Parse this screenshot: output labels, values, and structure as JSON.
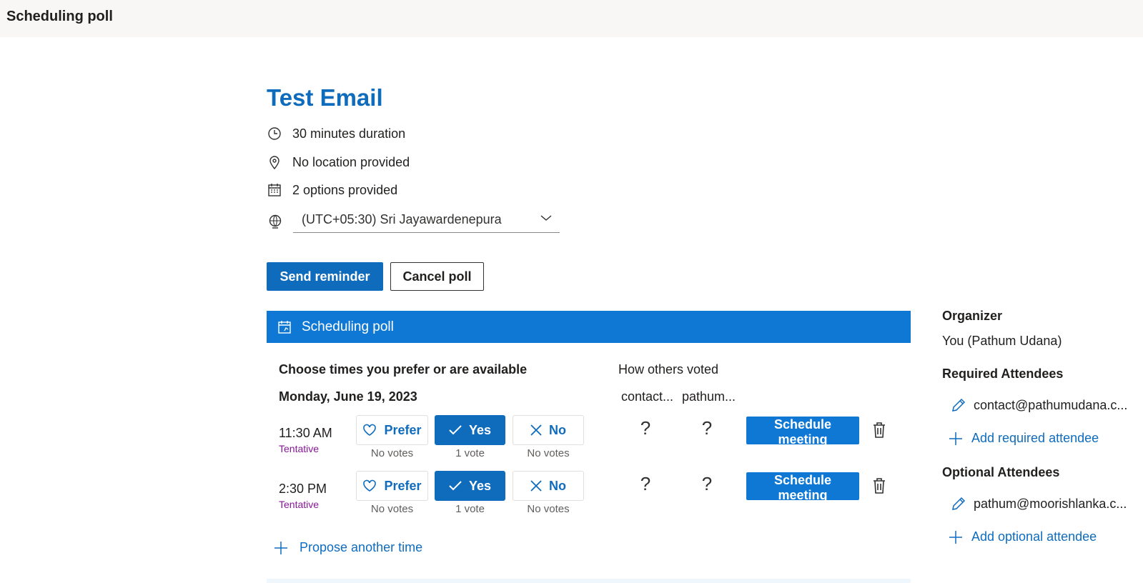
{
  "app": {
    "title": "Scheduling poll"
  },
  "event": {
    "title": "Test Email",
    "duration": "30 minutes duration",
    "location": "No location provided",
    "options": "2 options provided",
    "timezone": "(UTC+05:30) Sri Jayawardenepura"
  },
  "actions": {
    "send_reminder": "Send reminder",
    "cancel_poll": "Cancel poll"
  },
  "poll": {
    "header": "Scheduling poll",
    "choose_label": "Choose times you prefer or are available",
    "others_label": "How others voted",
    "date": "Monday, June 19, 2023",
    "voters": [
      "contact...",
      "pathum..."
    ],
    "prefer_label": "Prefer",
    "yes_label": "Yes",
    "no_label": "No",
    "schedule_label": "Schedule meeting",
    "slots": [
      {
        "time": "11:30 AM",
        "status": "Tentative",
        "prefer_votes": "No votes",
        "yes_votes": "1 vote",
        "no_votes": "No votes",
        "others": [
          "?",
          "?"
        ]
      },
      {
        "time": "2:30 PM",
        "status": "Tentative",
        "prefer_votes": "No votes",
        "yes_votes": "1 vote",
        "no_votes": "No votes",
        "others": [
          "?",
          "?"
        ]
      }
    ],
    "propose": "Propose another time"
  },
  "sidebar": {
    "organizer_label": "Organizer",
    "organizer": "You (Pathum Udana)",
    "required_label": "Required Attendees",
    "required_attendee": "contact@pathumudana.c...",
    "add_required": "Add required attendee",
    "optional_label": "Optional Attendees",
    "optional_attendee": "pathum@moorishlanka.c...",
    "add_optional": "Add optional attendee"
  },
  "colors": {
    "accent": "#0f6cbd",
    "header_bar": "#0f78d4",
    "tentative": "#881798"
  }
}
